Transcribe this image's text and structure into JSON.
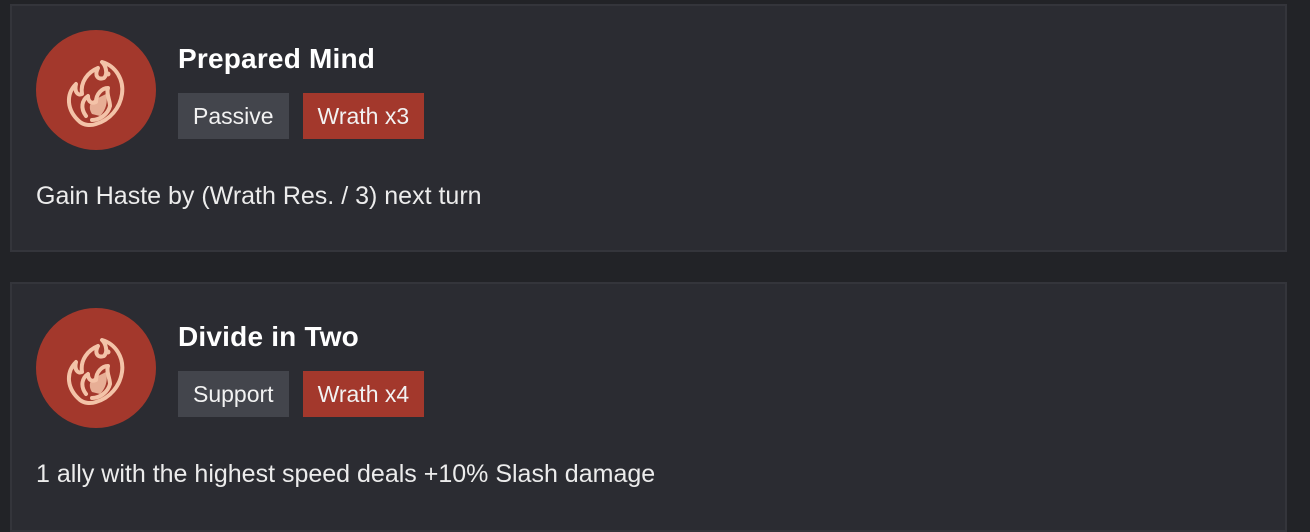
{
  "colors": {
    "page_background": "#222327",
    "card_background": "#2b2c32",
    "type_tag": "#43454c",
    "wrath_accent": "#a3382c",
    "wrath_icon_fill": "#f3c3a8"
  },
  "skills": [
    {
      "icon": "wrath-flame-icon",
      "title": "Prepared Mind",
      "type": "Passive",
      "cost": "Wrath x3",
      "description": "Gain Haste by (Wrath Res. / 3) next turn"
    },
    {
      "icon": "wrath-flame-icon",
      "title": "Divide in Two",
      "type": "Support",
      "cost": "Wrath x4",
      "description": "1 ally with the highest speed deals +10% Slash damage"
    }
  ]
}
